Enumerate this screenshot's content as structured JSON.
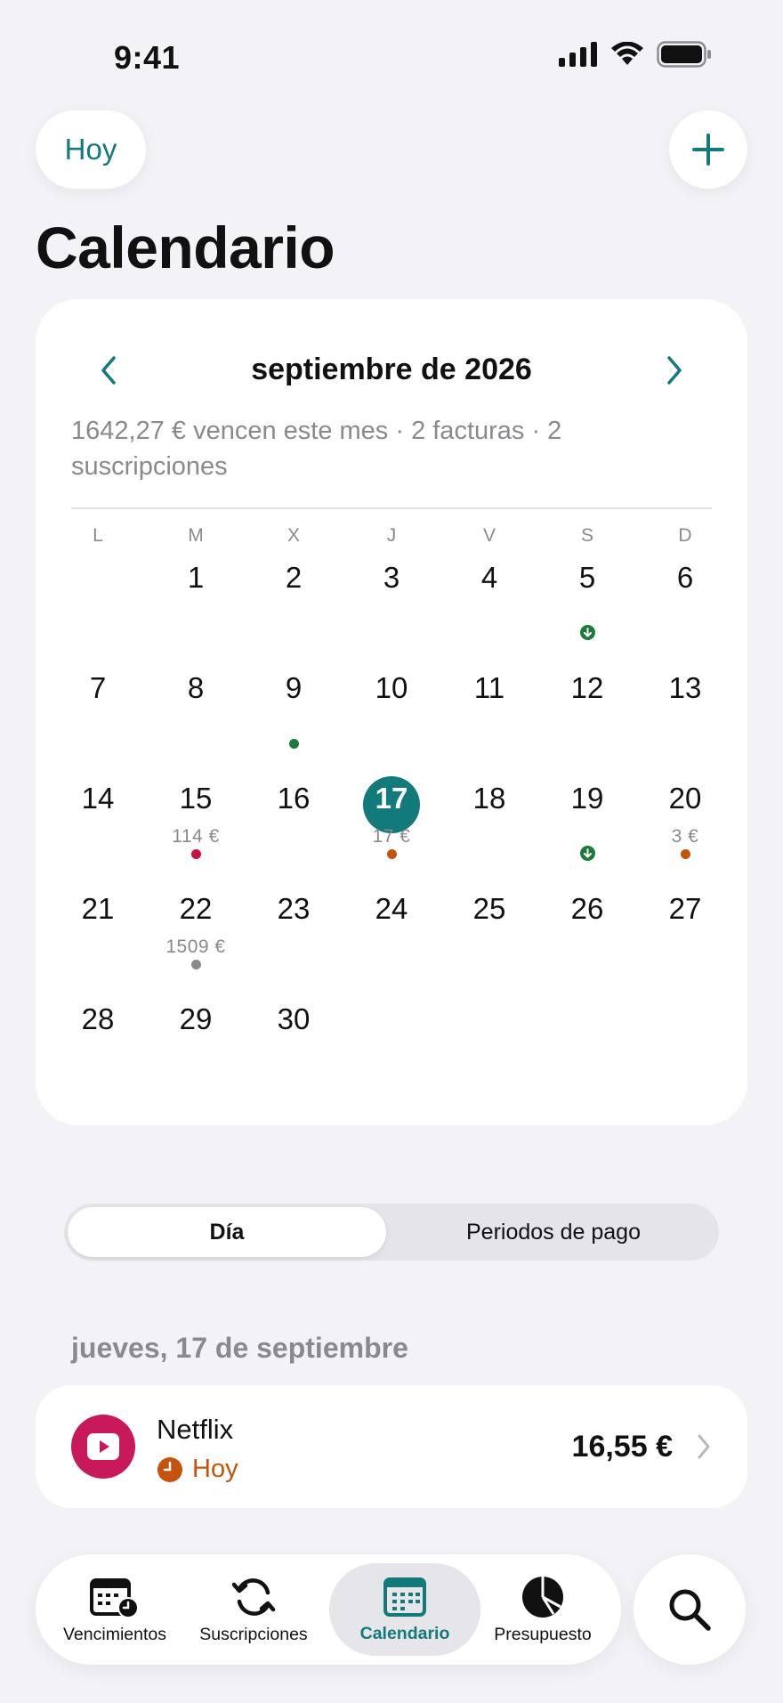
{
  "status_bar": {
    "time": "9:41"
  },
  "header": {
    "today_label": "Hoy",
    "title": "Calendario"
  },
  "calendar": {
    "month_title": "septiembre de 2026",
    "summary": "1642,27 € vencen este mes · 2 facturas · 2 suscripciones",
    "weekdays": [
      "L",
      "M",
      "X",
      "J",
      "V",
      "S",
      "D"
    ],
    "first_weekday_index": 1,
    "days_in_month": 30,
    "today": 17,
    "accent_color": "#127a7a",
    "markers": {
      "5": {
        "type": "income-arrow",
        "color": "#1e7a3a"
      },
      "9": {
        "type": "dot",
        "color": "#1e7a3a"
      },
      "15": {
        "type": "dot",
        "color": "#c8123c",
        "amount": "114 €"
      },
      "17": {
        "type": "dot",
        "color": "#c4530d",
        "amount": "17 €"
      },
      "19": {
        "type": "income-arrow",
        "color": "#1e7a3a"
      },
      "20": {
        "type": "dot",
        "color": "#c4530d",
        "amount": "3 €"
      },
      "22": {
        "type": "dot",
        "color": "#8a8a8e",
        "amount": "1509 €"
      }
    }
  },
  "segmented": {
    "day_label": "Día",
    "periods_label": "Periodos de pago",
    "selected": "day"
  },
  "day_section": {
    "date_label": "jueves, 17 de septiembre",
    "items": [
      {
        "name": "Netflix",
        "status": "Hoy",
        "amount": "16,55 €",
        "icon": "play-icon",
        "color": "#c8195a"
      }
    ]
  },
  "tabbar": {
    "tabs": [
      {
        "label": "Vencimientos",
        "icon": "calendar-clock-icon"
      },
      {
        "label": "Suscripciones",
        "icon": "sync-icon"
      },
      {
        "label": "Calendario",
        "icon": "calendar-grid-icon",
        "active": true
      },
      {
        "label": "Presupuesto",
        "icon": "pie-chart-icon"
      }
    ],
    "search_icon": "search-icon"
  }
}
